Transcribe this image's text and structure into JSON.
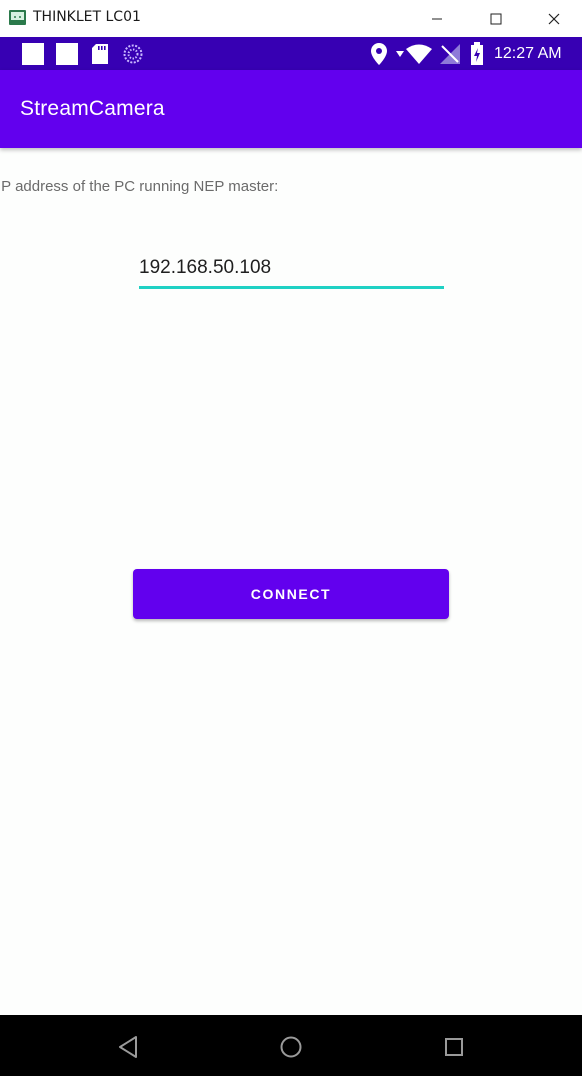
{
  "window": {
    "title": "THINKLET LC01",
    "icon": "android-emulator-icon",
    "controls": [
      "minimize-icon",
      "maximize-icon",
      "close-icon"
    ]
  },
  "status_bar": {
    "time": "12:27 AM",
    "left_icons": [
      "notification-square-icon",
      "notification-square-icon",
      "sd-card-icon",
      "sync-icon"
    ],
    "right_icons": [
      "location-icon",
      "data-arrow-icon",
      "wifi-icon",
      "no-signal-icon",
      "battery-charging-icon"
    ],
    "background": "#3700b3"
  },
  "app_bar": {
    "title": "StreamCamera",
    "background": "#6200ee"
  },
  "form": {
    "ip_label": "IP address of the PC running NEP master:",
    "ip_value": "192.168.50.108",
    "underline_color": "#1fd1c4"
  },
  "connect_button": {
    "label": "CONNECT",
    "background": "#6200ee"
  },
  "nav_bar": {
    "buttons": [
      "back-icon",
      "home-icon",
      "recents-icon"
    ]
  }
}
